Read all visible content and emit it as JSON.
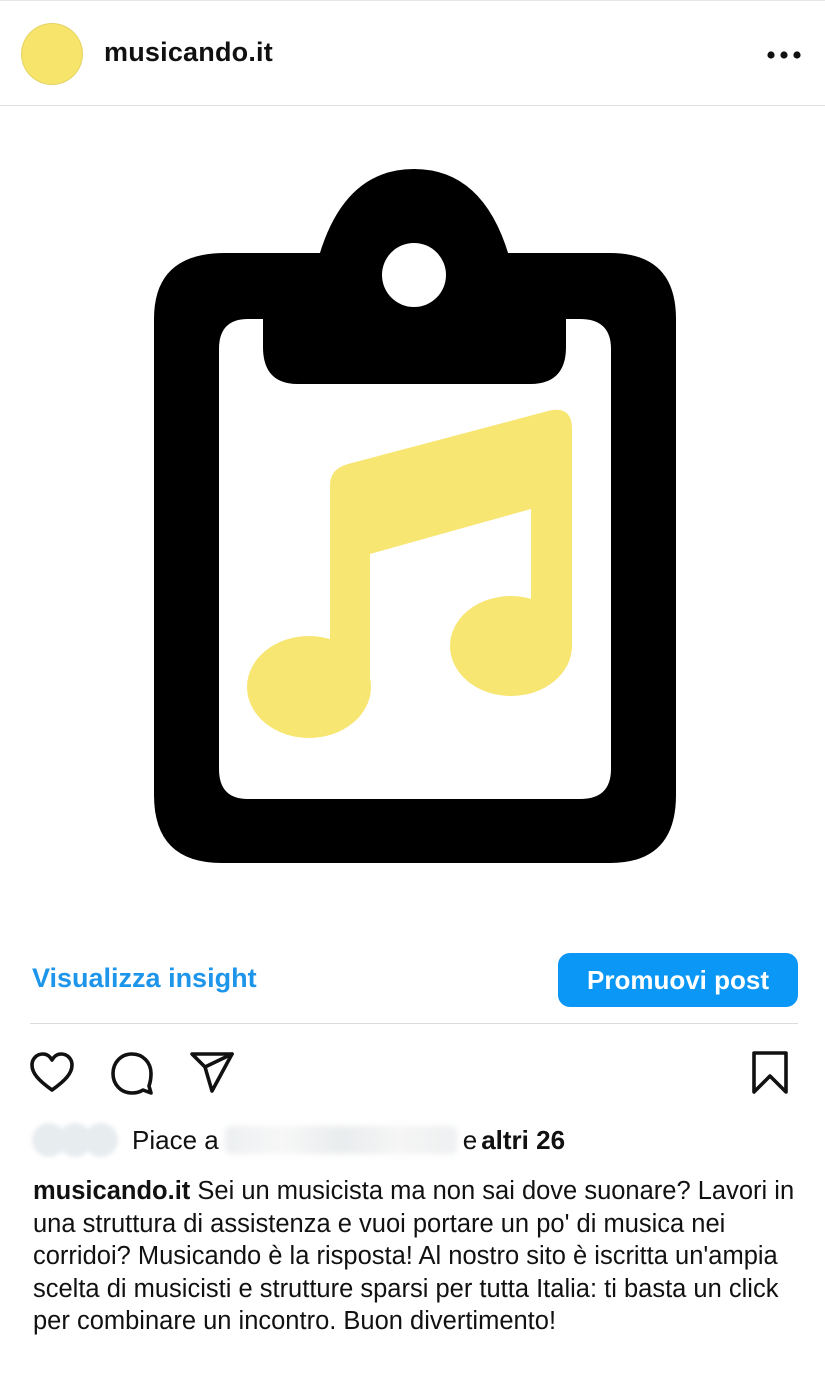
{
  "header": {
    "username": "musicando.it",
    "avatar_color": "#f7e46a",
    "more_icon": "more-horizontal-icon"
  },
  "post_image": {
    "description_icon": "clipboard-music-note-icon",
    "clipboard_color": "#000000",
    "note_color": "#f8e673"
  },
  "insights": {
    "link_label": "Visualizza insight",
    "promote_label": "Promuovi post",
    "link_color": "#1d95ea",
    "button_color": "#0a97f5"
  },
  "actions": {
    "like_icon": "heart-icon",
    "comment_icon": "comment-bubble-icon",
    "share_icon": "paper-plane-icon",
    "save_icon": "bookmark-icon"
  },
  "likes": {
    "prefix": "Piace a",
    "connector": "e",
    "more": "altri 26"
  },
  "caption": {
    "username": "musicando.it",
    "text": "Sei un musicista ma non sai dove suonare? Lavori in una struttura di assistenza e vuoi portare un po' di musica nei corridoi? Musicando è la risposta! Al nostro sito è iscritta un'ampia scelta di musicisti e strutture sparsi per tutta Italia: ti basta un click per combinare un incontro. Buon divertimento!"
  }
}
